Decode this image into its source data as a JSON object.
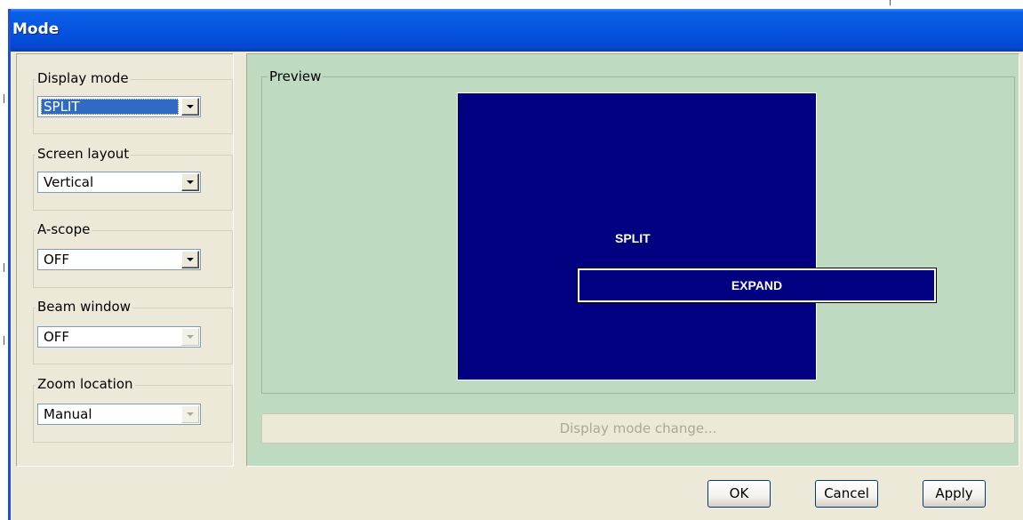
{
  "window": {
    "title": "Mode"
  },
  "settings": {
    "display_mode": {
      "label": "Display mode",
      "value": "SPLIT"
    },
    "screen_layout": {
      "label": "Screen layout",
      "value": "Vertical"
    },
    "a_scope": {
      "label": "A-scope",
      "value": "OFF"
    },
    "beam_window": {
      "label": "Beam window",
      "value": "OFF"
    },
    "zoom_location": {
      "label": "Zoom location",
      "value": "Manual"
    }
  },
  "preview": {
    "label": "Preview",
    "main_label": "SPLIT",
    "expand_label": "EXPAND",
    "change_button": "Display mode change..."
  },
  "buttons": {
    "ok": "OK",
    "cancel": "Cancel",
    "apply": "Apply"
  },
  "colors": {
    "title_bar": "#0654e0",
    "preview_background": "#bedbc1",
    "screen_background": "#000080",
    "selection": "#316ac5"
  }
}
